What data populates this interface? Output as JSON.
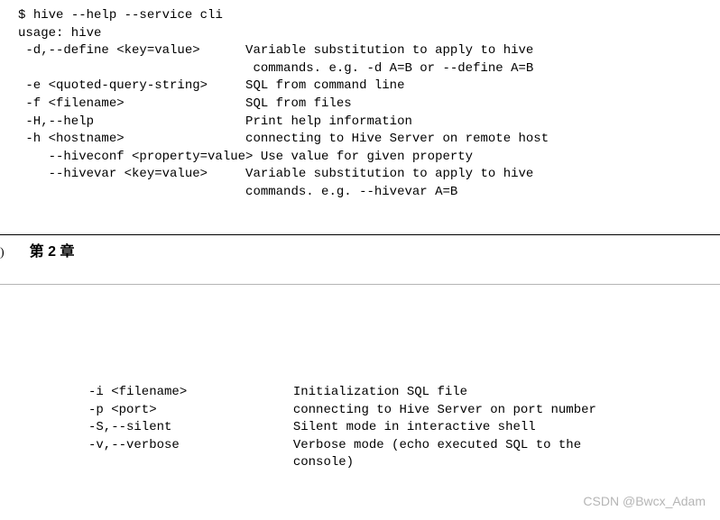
{
  "command": {
    "prompt": "$",
    "line": "hive --help --service cli"
  },
  "usage": "usage: hive",
  "options_top": [
    {
      "flag": " -d,--define <key=value>      ",
      "desc": "Variable substitution to apply to hive"
    },
    {
      "flag": "                              ",
      "desc": " commands. e.g. -d A=B or --define A=B"
    },
    {
      "flag": " -e <quoted-query-string>     ",
      "desc": "SQL from command line"
    },
    {
      "flag": " -f <filename>                ",
      "desc": "SQL from files"
    },
    {
      "flag": " -H,--help                    ",
      "desc": "Print help information"
    },
    {
      "flag": " -h <hostname>                ",
      "desc": "connecting to Hive Server on remote host"
    },
    {
      "flag": "    --hiveconf <property=value> ",
      "desc": "Use value for given property"
    },
    {
      "flag": "    --hivevar <key=value>     ",
      "desc": "Variable substitution to apply to hive"
    },
    {
      "flag": "                              ",
      "desc": "commands. e.g. --hivevar A=B"
    }
  ],
  "chapter": {
    "page": ")",
    "title": "第 2 章"
  },
  "options_bottom": [
    {
      "flag": "-i <filename>              ",
      "desc": "Initialization SQL file"
    },
    {
      "flag": "-p <port>                  ",
      "desc": "connecting to Hive Server on port number"
    },
    {
      "flag": "-S,--silent                ",
      "desc": "Silent mode in interactive shell"
    },
    {
      "flag": "-v,--verbose               ",
      "desc": "Verbose mode (echo executed SQL to the"
    },
    {
      "flag": "                           ",
      "desc": "console)"
    }
  ],
  "watermark": "CSDN @Bwcx_Adam"
}
